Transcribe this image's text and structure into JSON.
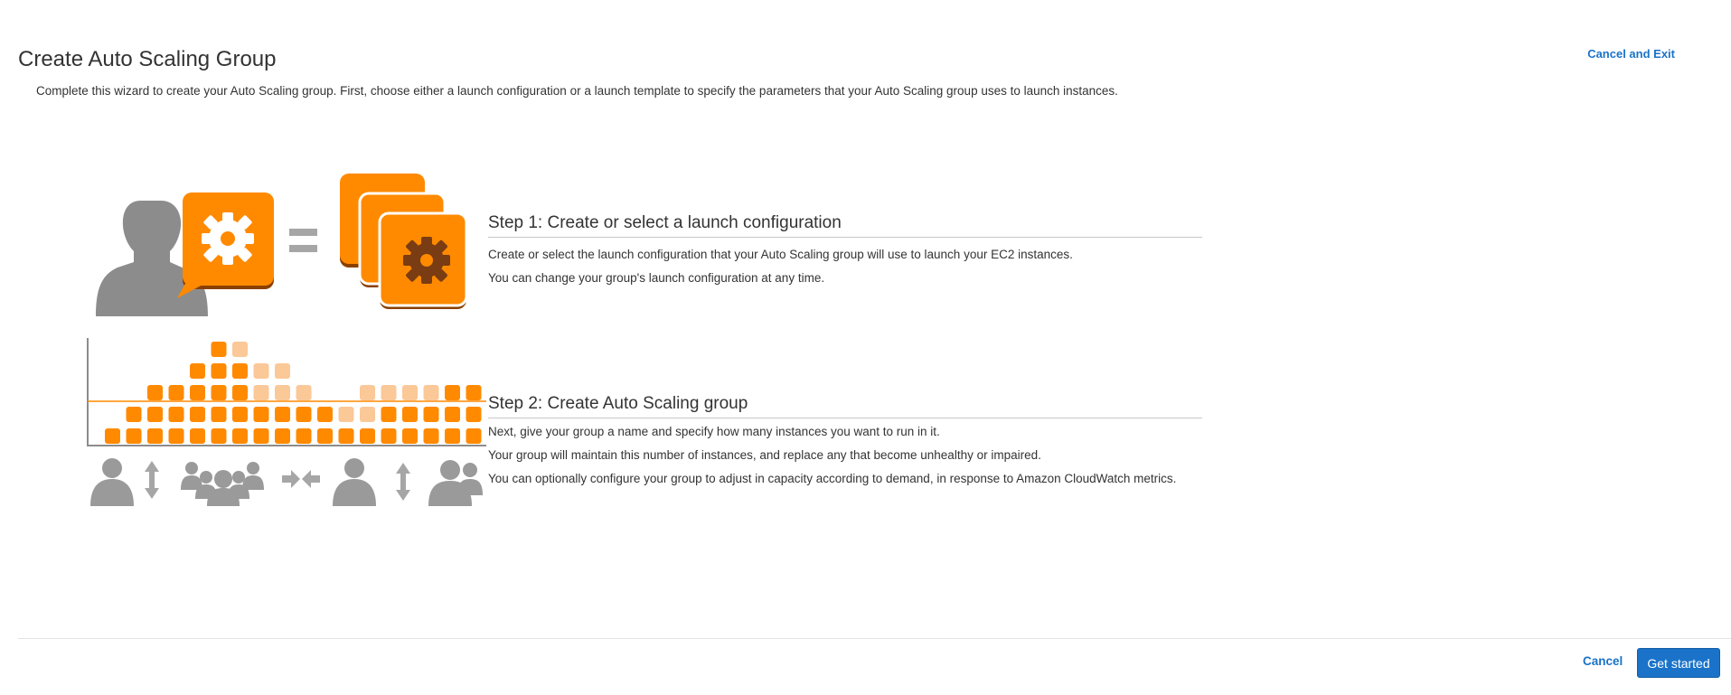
{
  "header": {
    "title": "Create Auto Scaling Group",
    "cancel_exit_label": "Cancel and Exit",
    "intro": "Complete this wizard to create your Auto Scaling group. First, choose either a launch configuration or a launch template to specify the parameters that your Auto Scaling group uses to launch instances."
  },
  "steps": [
    {
      "title": "Step 1: Create or select a launch configuration",
      "lines": [
        "Create or select the launch configuration that your Auto Scaling group will use to launch your EC2 instances.",
        "You can change your group's launch configuration at any time."
      ]
    },
    {
      "title": "Step 2: Create Auto Scaling group",
      "lines": [
        "Next, give your group a name and specify how many instances you want to run in it.",
        "Your group will maintain this number of instances, and replace any that become unhealthy or impaired.",
        "You can optionally configure your group to adjust in capacity according to demand, in response to Amazon CloudWatch metrics."
      ]
    }
  ],
  "illustration": {
    "colors": {
      "orange": "#ff8a00",
      "pale": "#fbc898",
      "grey": "#8c8c8c",
      "gear_dark": "#7a3c12"
    },
    "icons": [
      "person-icon",
      "settings-gear-icon",
      "equals-icon",
      "launch-config-stack-icon",
      "capacity-chart",
      "scaling-people-icons"
    ]
  },
  "footer": {
    "cancel_label": "Cancel",
    "primary_label": "Get started"
  }
}
